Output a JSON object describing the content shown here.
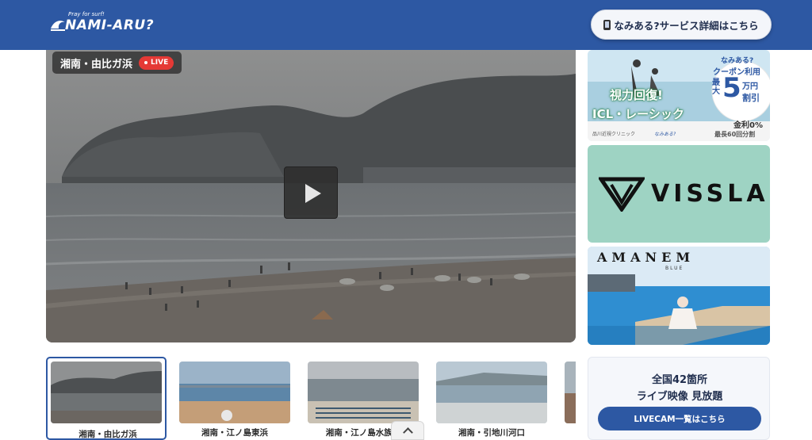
{
  "header": {
    "logo_tagline": "Pray for surf!",
    "logo_text": "NAMI-ARU?",
    "service_button": "なみある?サービス詳細はこちら"
  },
  "player": {
    "location": "湘南・由比ガ浜",
    "live_badge": "LIVE"
  },
  "ads": {
    "ad1": {
      "headline": "視力回復!",
      "subhead": "ICL・レーシック",
      "badge_top": "なみある?",
      "badge_mid": "クーポン利用",
      "badge_max": "最大",
      "badge_num": "5",
      "badge_unit": "万円",
      "badge_off": "割引",
      "interest": "金利0%",
      "installments": "最長60回分割",
      "clinic": "品川近視クリニック",
      "partner": "なみある?"
    },
    "ad2": {
      "brand": "VISSLA"
    },
    "ad3": {
      "brand": "AMANEM",
      "sub": "BLUE"
    },
    "ad4": {
      "line1": "全国42箇所",
      "line2": "ライブ映像 見放題",
      "button": "LIVECAM一覧はこちら"
    }
  },
  "thumbnails": [
    {
      "label": "湘南・由比ガ浜",
      "active": true
    },
    {
      "label": "湘南・江ノ島東浜",
      "active": false
    },
    {
      "label": "湘南・江ノ島水族館",
      "active": false
    },
    {
      "label": "湘南・引地川河口",
      "active": false
    }
  ],
  "colors": {
    "header": "#2d58a3",
    "live": "#e53935",
    "accent": "#2d58a3"
  }
}
